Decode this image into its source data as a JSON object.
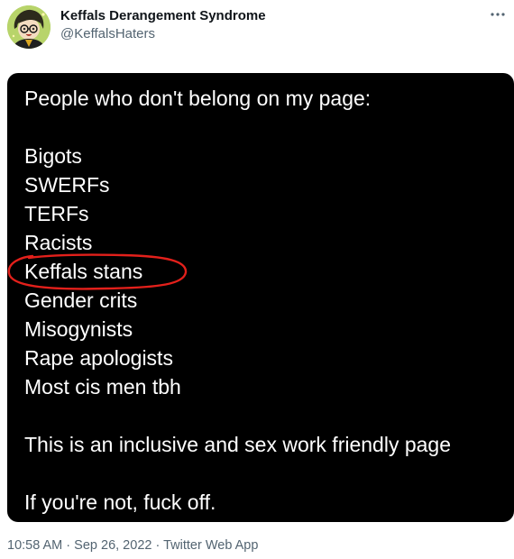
{
  "author": {
    "display_name": "Keffals Derangement Syndrome",
    "handle": "@KeffalsHaters"
  },
  "more_icon": "ellipsis-icon",
  "media": {
    "lines": [
      "People who don't belong on my page:",
      "",
      "Bigots",
      "SWERFs",
      "TERFs",
      "Racists",
      "Keffals stans",
      "Gender crits",
      "Misogynists",
      "Rape apologists",
      "Most cis men tbh",
      "",
      "This is an inclusive and sex work friendly page",
      "",
      "If you're not, fuck off."
    ],
    "highlighted_line": "Keffals stans",
    "highlight_color": "#e3201b",
    "background": "#000000",
    "text_color": "#ffffff"
  },
  "meta": {
    "time": "10:58 AM",
    "separator": "·",
    "date": "Sep 26, 2022",
    "source": "Twitter Web App"
  }
}
